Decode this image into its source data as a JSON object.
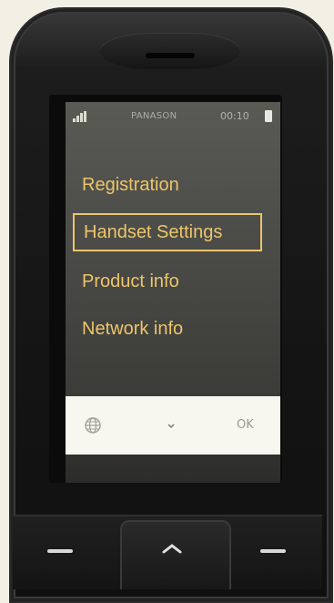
{
  "status_bar": {
    "carrier": "PANASON",
    "time": "00:10",
    "signal_icon": "signal-icon",
    "battery_icon": "battery-icon"
  },
  "menu": {
    "items": [
      {
        "label": "Registration",
        "selected": false
      },
      {
        "label": "Handset Settings",
        "selected": true
      },
      {
        "label": "Product info",
        "selected": false
      },
      {
        "label": "Network info",
        "selected": false
      }
    ]
  },
  "softkeys": {
    "left_icon": "globe-icon",
    "center_icon": "chevron-down-icon",
    "right_label": "OK"
  },
  "colors": {
    "menu_text": "#ecc56a",
    "screen_bg": "#4a4a46",
    "softkey_bg": "#f7f6ef"
  }
}
